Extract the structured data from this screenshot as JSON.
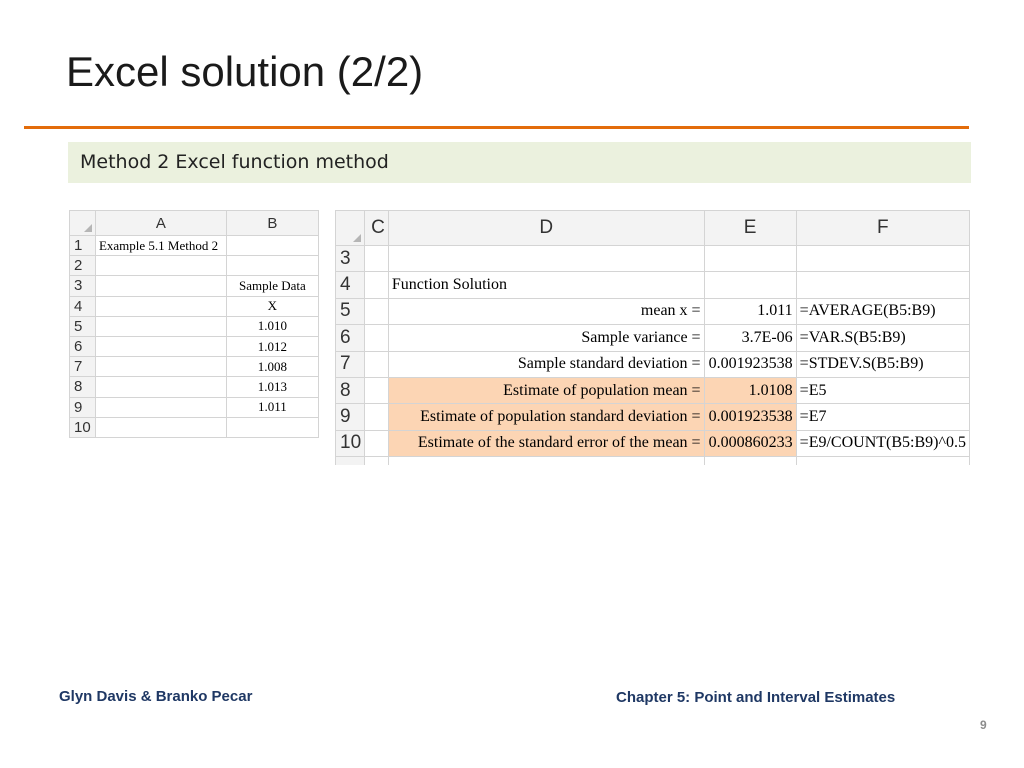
{
  "slide": {
    "title": "Excel solution (2/2)",
    "subtitle": "Method 2 Excel function method",
    "footer_left": "Glyn Davis & Branko Pecar",
    "footer_right": "Chapter 5: Point and Interval Estimates",
    "page_number": "9",
    "colors": {
      "title_rule": "#e36c0a",
      "subtitle_bar": "#ebf1de",
      "highlight": "#fcd5b4",
      "footer_text": "#1f3864"
    }
  },
  "sheet_left": {
    "col_headers": [
      "A",
      "B"
    ],
    "rows": [
      {
        "num": "1",
        "a": "Example 5.1 Method 2",
        "b": ""
      },
      {
        "num": "2",
        "a": "",
        "b": ""
      },
      {
        "num": "3",
        "a": "",
        "b": "Sample Data"
      },
      {
        "num": "4",
        "a": "",
        "b": "X"
      },
      {
        "num": "5",
        "a": "",
        "b": "1.010"
      },
      {
        "num": "6",
        "a": "",
        "b": "1.012"
      },
      {
        "num": "7",
        "a": "",
        "b": "1.008"
      },
      {
        "num": "8",
        "a": "",
        "b": "1.013"
      },
      {
        "num": "9",
        "a": "",
        "b": "1.011"
      },
      {
        "num": "10",
        "a": "",
        "b": ""
      }
    ]
  },
  "sheet_right": {
    "col_headers": [
      "C",
      "D",
      "E",
      "F"
    ],
    "rows": [
      {
        "num": "3",
        "d": "",
        "e": "",
        "f": ""
      },
      {
        "num": "4",
        "d": "Function Solution",
        "e": "",
        "f": ""
      },
      {
        "num": "5",
        "d": "mean x =",
        "e": "1.011",
        "f": "=AVERAGE(B5:B9)"
      },
      {
        "num": "6",
        "d": "Sample variance =",
        "e": "3.7E-06",
        "f": "=VAR.S(B5:B9)"
      },
      {
        "num": "7",
        "d": "Sample standard deviation =",
        "e": "0.001923538",
        "f": "=STDEV.S(B5:B9)"
      },
      {
        "num": "8",
        "d": "Estimate of population mean =",
        "e": "1.0108",
        "f": "=E5"
      },
      {
        "num": "9",
        "d": "Estimate of population standard deviation =",
        "e": "0.001923538",
        "f": "=E7"
      },
      {
        "num": "10",
        "d": "Estimate of the standard error of the mean =",
        "e": "0.000860233",
        "f": "=E9/COUNT(B5:B9)^0.5"
      }
    ]
  }
}
